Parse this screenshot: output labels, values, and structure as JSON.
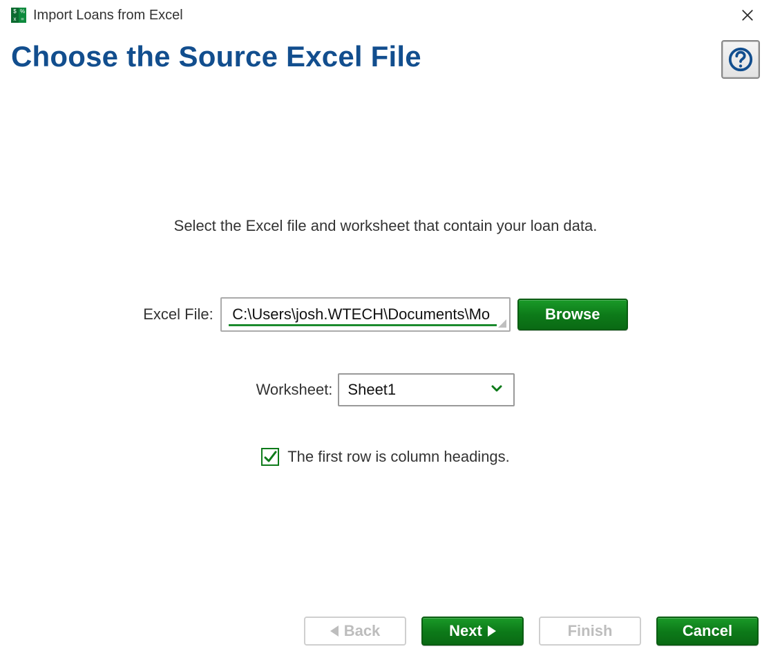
{
  "window": {
    "title": "Import Loans from Excel"
  },
  "header": {
    "page_title": "Choose the Source Excel File"
  },
  "instruction": "Select the Excel file and worksheet that contain your loan data.",
  "file": {
    "label": "Excel File:",
    "value": "C:\\Users\\josh.WTECH\\Documents\\Mo",
    "browse_label": "Browse"
  },
  "worksheet": {
    "label": "Worksheet:",
    "selected": "Sheet1"
  },
  "checkbox": {
    "checked": true,
    "label": "The first row is column headings."
  },
  "footer": {
    "back": "Back",
    "next": "Next",
    "finish": "Finish",
    "cancel": "Cancel"
  },
  "colors": {
    "accent_blue": "#124e8e",
    "accent_green": "#0d7a19"
  }
}
